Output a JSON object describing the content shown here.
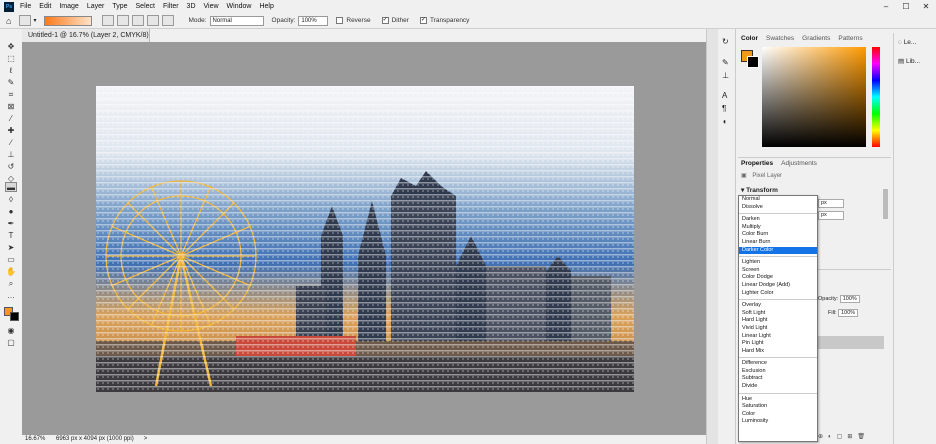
{
  "app": {
    "logo_text": "Ps"
  },
  "menu": {
    "items": [
      "File",
      "Edit",
      "Image",
      "Layer",
      "Type",
      "Select",
      "Filter",
      "3D",
      "View",
      "Window",
      "Help"
    ]
  },
  "window_controls": {
    "minimize": "–",
    "maximize": "☐",
    "close": "✕"
  },
  "options_bar": {
    "mode_label": "Mode:",
    "mode_value": "Normal",
    "opacity_label": "Opacity:",
    "opacity_value": "100%",
    "reverse_label": "Reverse",
    "dither_label": "Dither",
    "transparency_label": "Transparency"
  },
  "document": {
    "tab_title": "Untitled-1 @ 16.7% (Layer 2, CMYK/8) *",
    "close_glyph": "×"
  },
  "status_bar": {
    "zoom": "16.67%",
    "info": "6963 px x 4094 px (1000 ppi)",
    "arrow": ">"
  },
  "panels": {
    "color_tabs": [
      "Color",
      "Swatches",
      "Gradients",
      "Patterns"
    ],
    "properties_tabs": [
      "Properties",
      "Adjustments"
    ],
    "pixel_layer_label": "Pixel Layer",
    "transform_label": "Transform",
    "w_value": "px",
    "h_value": "px",
    "opacity_label": "Opacity:",
    "opacity_value": "100%",
    "fill_label": "Fill:",
    "fill_value": "100%"
  },
  "libraries": {
    "items": [
      "Le...",
      "Lib..."
    ]
  },
  "blend_modes": {
    "group1": [
      "Normal",
      "Dissolve"
    ],
    "group2": [
      "Darken",
      "Multiply",
      "Color Burn",
      "Linear Burn",
      "Darker Color"
    ],
    "group3": [
      "Lighten",
      "Screen",
      "Color Dodge",
      "Linear Dodge (Add)",
      "Lighter Color"
    ],
    "group4": [
      "Overlay",
      "Soft Light",
      "Hard Light",
      "Vivid Light",
      "Linear Light",
      "Pin Light",
      "Hard Mix"
    ],
    "group5": [
      "Difference",
      "Exclusion",
      "Subtract",
      "Divide"
    ],
    "group6": [
      "Hue",
      "Saturation",
      "Color",
      "Luminosity"
    ],
    "selected": "Darker Color"
  },
  "colors": {
    "foreground": "#f39a1a",
    "background": "#000000",
    "picker_hue": "#ff9a00",
    "accent": "#1473e6"
  }
}
